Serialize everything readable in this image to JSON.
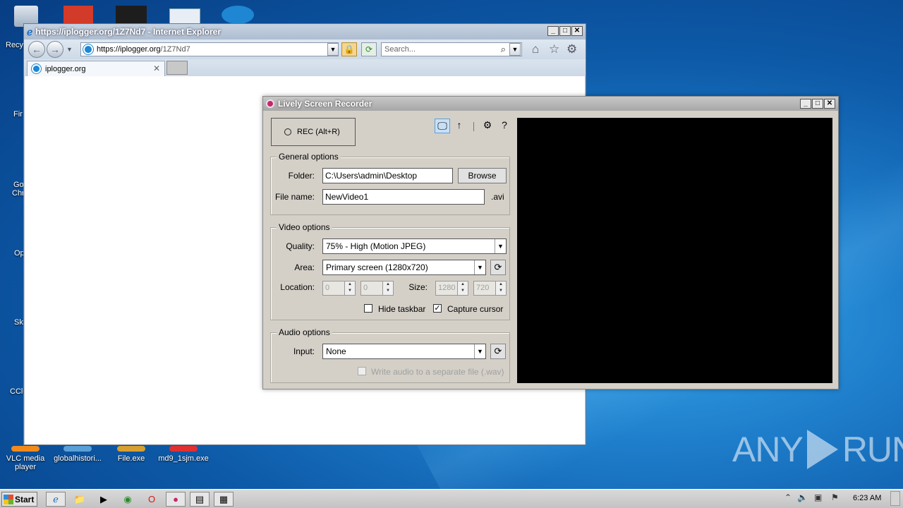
{
  "ie": {
    "title": "https://iplogger.org/1Z7Nd7 - Internet Explorer",
    "address_scheme": "https://iplogger.org",
    "address_path": "/1Z7Nd7",
    "search_placeholder": "Search...",
    "tab_label": "iplogger.org"
  },
  "recorder": {
    "title": "Lively Screen Recorder",
    "rec_label": "REC (Alt+R)",
    "general": {
      "legend": "General options",
      "folder_label": "Folder:",
      "folder_value": "C:\\Users\\admin\\Desktop",
      "browse_label": "Browse",
      "filename_label": "File name:",
      "filename_value": "NewVideo1",
      "extension": ".avi"
    },
    "video": {
      "legend": "Video options",
      "quality_label": "Quality:",
      "quality_value": "75% - High (Motion JPEG)",
      "area_label": "Area:",
      "area_value": "Primary screen (1280x720)",
      "location_label": "Location:",
      "location_x": "0",
      "location_y": "0",
      "size_label": "Size:",
      "size_w": "1280",
      "size_h": "720",
      "hide_taskbar_label": "Hide taskbar",
      "hide_taskbar_checked": false,
      "capture_cursor_label": "Capture cursor",
      "capture_cursor_checked": true
    },
    "audio": {
      "legend": "Audio options",
      "input_label": "Input:",
      "input_value": "None",
      "separate_file_label": "Write audio to a separate file (.wav)",
      "separate_file_checked": false
    }
  },
  "desktop": {
    "icons": [
      {
        "label": "VLC media player",
        "icon": "vlc-icon",
        "color": "#f08a1c"
      },
      {
        "label": "globalhistori...",
        "icon": "file-icon",
        "color": "#5aa0d8"
      },
      {
        "label": "File.exe",
        "icon": "exe-icon",
        "color": "#d8a030"
      },
      {
        "label": "md9_1sjm.exe",
        "icon": "exe-icon",
        "color": "#e03030"
      }
    ],
    "cutoff_labels": [
      "Recy",
      "Fir",
      "Go",
      "Chr",
      "Op",
      "Sk",
      "CCle"
    ],
    "watermark_left": "ANY",
    "watermark_right": "RUN"
  },
  "taskbar": {
    "start_label": "Start",
    "clock": "6:23 AM"
  }
}
